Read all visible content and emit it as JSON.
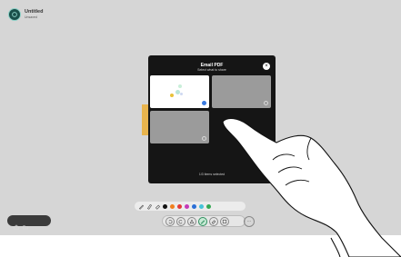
{
  "document": {
    "title": "Untitled",
    "subtitle": "Unsaved",
    "avatar_icon": "board-app-icon"
  },
  "dialog": {
    "title": "Email PDF",
    "subtitle": "Select what to share",
    "close_icon": "close-icon",
    "thumbnails": [
      {
        "name": "page-1",
        "selected": true
      },
      {
        "name": "page-2",
        "selected": false
      },
      {
        "name": "page-3",
        "selected": false
      }
    ],
    "selected_text": "1/3 items selected"
  },
  "palette": {
    "tools": [
      "pen-icon",
      "marker-icon",
      "eraser-icon"
    ],
    "colors": [
      "#111111",
      "#f07f1e",
      "#e23a3a",
      "#c43ab8",
      "#2b6fd6",
      "#45c3d9",
      "#34a853"
    ]
  },
  "toolbar": {
    "buttons": [
      "undo-icon",
      "redo-icon",
      "shape-icon",
      "pen-tool-icon",
      "eraser-tool-icon",
      "sticky-note-icon"
    ],
    "active_index": 3,
    "more_icon": "more-icon"
  },
  "left_pill": {
    "icons": [
      "home-icon",
      "folder-icon"
    ]
  },
  "colors": {
    "canvas": "#d6d6d6",
    "dialog_bg": "#151515",
    "accent": "#2e8f5e",
    "selection": "#3a7be0"
  }
}
